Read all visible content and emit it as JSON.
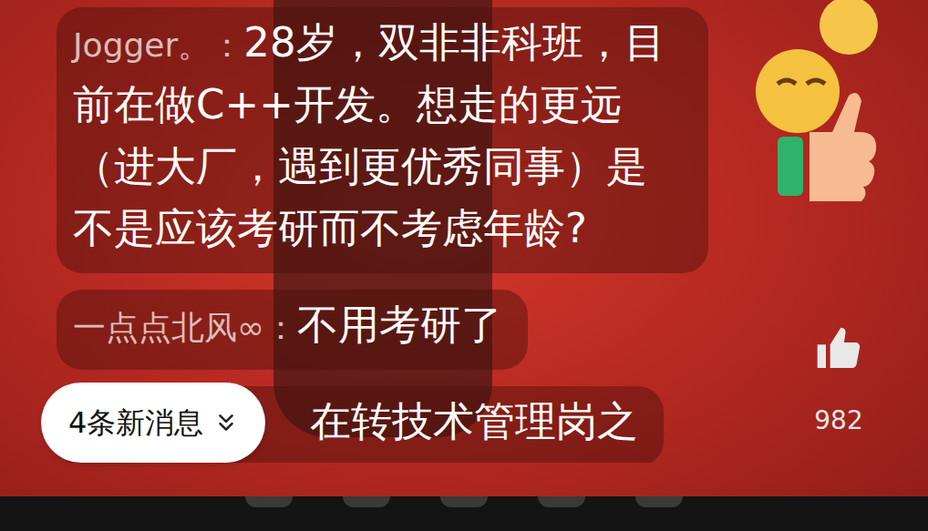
{
  "messages": [
    {
      "user": "Jogger。",
      "separator": "：",
      "text": "28岁，双非非科班，目前在做C++开发。想走的更远（进大厂，遇到更优秀同事）是不是应该考研而不考虑年龄?"
    },
    {
      "user": "一点点北风∞",
      "separator": "：",
      "text": "不用考研了"
    },
    {
      "text": "在转技术管理岗之"
    }
  ],
  "new_messages": {
    "label": "4条新消息"
  },
  "likes": {
    "count": "982"
  }
}
